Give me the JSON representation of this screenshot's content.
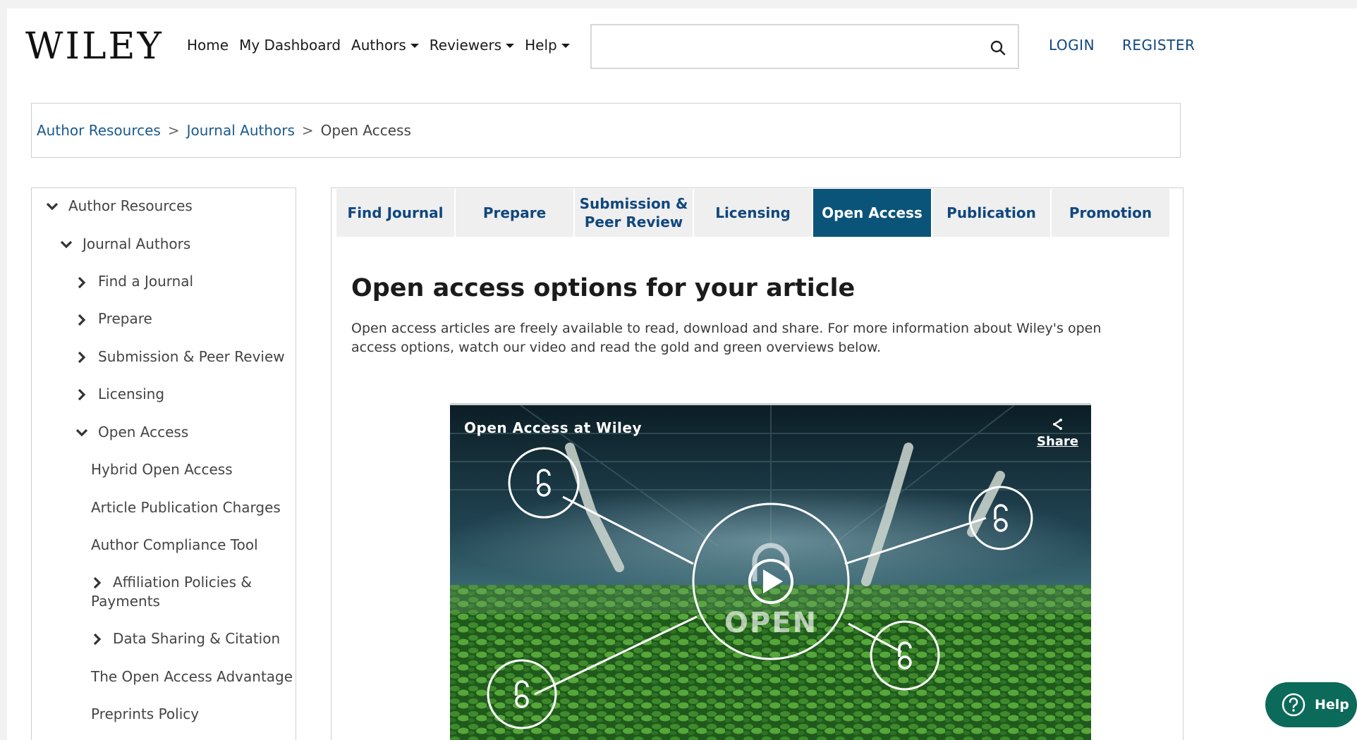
{
  "header": {
    "logo": "WILEY",
    "nav": [
      {
        "label": "Home",
        "dropdown": false
      },
      {
        "label": "My Dashboard",
        "dropdown": false
      },
      {
        "label": "Authors",
        "dropdown": true
      },
      {
        "label": "Reviewers",
        "dropdown": true
      },
      {
        "label": "Help",
        "dropdown": true
      }
    ],
    "search": {
      "value": "",
      "placeholder": ""
    },
    "login": "LOGIN",
    "register": "REGISTER"
  },
  "breadcrumb": {
    "items": [
      "Author Resources",
      "Journal Authors"
    ],
    "separator": ">",
    "current": "Open Access"
  },
  "sidebar": {
    "items": [
      {
        "label": "Author Resources",
        "icon": "chevron-down-icon"
      },
      {
        "label": "Journal Authors",
        "icon": "chevron-down-icon"
      },
      {
        "label": "Find a Journal",
        "icon": "chevron-right-icon"
      },
      {
        "label": "Prepare",
        "icon": "chevron-right-icon"
      },
      {
        "label": "Submission & Peer Review",
        "icon": "chevron-right-icon"
      },
      {
        "label": "Licensing",
        "icon": "chevron-right-icon"
      },
      {
        "label": "Open Access",
        "icon": "chevron-down-icon"
      },
      {
        "label": "Hybrid Open Access",
        "icon": ""
      },
      {
        "label": "Article Publication Charges",
        "icon": ""
      },
      {
        "label": "Author Compliance Tool",
        "icon": ""
      },
      {
        "label_line1": "Affiliation Policies &",
        "label_line2": "Payments",
        "icon": "chevron-right-icon"
      },
      {
        "label": "Data Sharing & Citation",
        "icon": "chevron-right-icon"
      },
      {
        "label": "The Open Access Advantage",
        "icon": ""
      },
      {
        "label": "Preprints Policy",
        "icon": ""
      }
    ]
  },
  "tabs": [
    {
      "line1": "Find Journal",
      "line2": "",
      "active": false
    },
    {
      "line1": "Prepare",
      "line2": "",
      "active": false
    },
    {
      "line1": "Submission &",
      "line2": "Peer Review",
      "active": false
    },
    {
      "line1": "Licensing",
      "line2": "",
      "active": false
    },
    {
      "line1": "Open Access",
      "line2": "",
      "active": true
    },
    {
      "line1": "Publication",
      "line2": "",
      "active": false
    },
    {
      "line1": "Promotion",
      "line2": "",
      "active": false
    }
  ],
  "content": {
    "title": "Open access options for your article",
    "intro": "Open access articles are freely available to read, download and share. For more information about Wiley's open access options, watch our video and read the gold and green overviews below."
  },
  "video": {
    "title": "Open Access at Wiley",
    "share_label": "Share",
    "center_text": "OPEN"
  },
  "help_button": {
    "label": "Help"
  },
  "colors": {
    "link": "#1a5a8e",
    "accent": "#10477d",
    "active_tab": "#0b5479",
    "help_button": "#0c6a5a"
  }
}
